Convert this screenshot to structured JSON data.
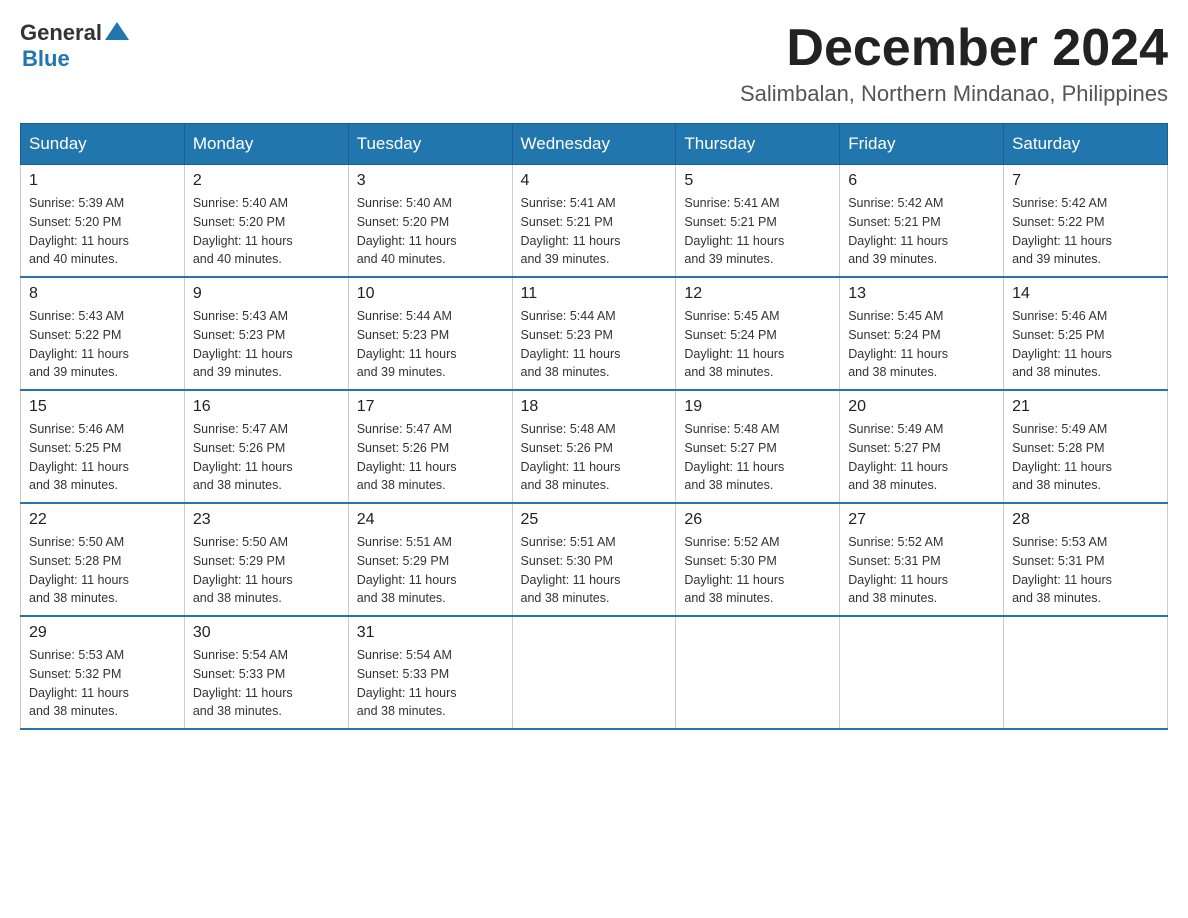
{
  "header": {
    "logo_general": "General",
    "logo_blue": "Blue",
    "month_title": "December 2024",
    "location": "Salimbalan, Northern Mindanao, Philippines"
  },
  "days_of_week": [
    "Sunday",
    "Monday",
    "Tuesday",
    "Wednesday",
    "Thursday",
    "Friday",
    "Saturday"
  ],
  "weeks": [
    [
      {
        "date": "1",
        "sunrise": "5:39 AM",
        "sunset": "5:20 PM",
        "daylight": "11 hours and 40 minutes."
      },
      {
        "date": "2",
        "sunrise": "5:40 AM",
        "sunset": "5:20 PM",
        "daylight": "11 hours and 40 minutes."
      },
      {
        "date": "3",
        "sunrise": "5:40 AM",
        "sunset": "5:20 PM",
        "daylight": "11 hours and 40 minutes."
      },
      {
        "date": "4",
        "sunrise": "5:41 AM",
        "sunset": "5:21 PM",
        "daylight": "11 hours and 39 minutes."
      },
      {
        "date": "5",
        "sunrise": "5:41 AM",
        "sunset": "5:21 PM",
        "daylight": "11 hours and 39 minutes."
      },
      {
        "date": "6",
        "sunrise": "5:42 AM",
        "sunset": "5:21 PM",
        "daylight": "11 hours and 39 minutes."
      },
      {
        "date": "7",
        "sunrise": "5:42 AM",
        "sunset": "5:22 PM",
        "daylight": "11 hours and 39 minutes."
      }
    ],
    [
      {
        "date": "8",
        "sunrise": "5:43 AM",
        "sunset": "5:22 PM",
        "daylight": "11 hours and 39 minutes."
      },
      {
        "date": "9",
        "sunrise": "5:43 AM",
        "sunset": "5:23 PM",
        "daylight": "11 hours and 39 minutes."
      },
      {
        "date": "10",
        "sunrise": "5:44 AM",
        "sunset": "5:23 PM",
        "daylight": "11 hours and 39 minutes."
      },
      {
        "date": "11",
        "sunrise": "5:44 AM",
        "sunset": "5:23 PM",
        "daylight": "11 hours and 38 minutes."
      },
      {
        "date": "12",
        "sunrise": "5:45 AM",
        "sunset": "5:24 PM",
        "daylight": "11 hours and 38 minutes."
      },
      {
        "date": "13",
        "sunrise": "5:45 AM",
        "sunset": "5:24 PM",
        "daylight": "11 hours and 38 minutes."
      },
      {
        "date": "14",
        "sunrise": "5:46 AM",
        "sunset": "5:25 PM",
        "daylight": "11 hours and 38 minutes."
      }
    ],
    [
      {
        "date": "15",
        "sunrise": "5:46 AM",
        "sunset": "5:25 PM",
        "daylight": "11 hours and 38 minutes."
      },
      {
        "date": "16",
        "sunrise": "5:47 AM",
        "sunset": "5:26 PM",
        "daylight": "11 hours and 38 minutes."
      },
      {
        "date": "17",
        "sunrise": "5:47 AM",
        "sunset": "5:26 PM",
        "daylight": "11 hours and 38 minutes."
      },
      {
        "date": "18",
        "sunrise": "5:48 AM",
        "sunset": "5:26 PM",
        "daylight": "11 hours and 38 minutes."
      },
      {
        "date": "19",
        "sunrise": "5:48 AM",
        "sunset": "5:27 PM",
        "daylight": "11 hours and 38 minutes."
      },
      {
        "date": "20",
        "sunrise": "5:49 AM",
        "sunset": "5:27 PM",
        "daylight": "11 hours and 38 minutes."
      },
      {
        "date": "21",
        "sunrise": "5:49 AM",
        "sunset": "5:28 PM",
        "daylight": "11 hours and 38 minutes."
      }
    ],
    [
      {
        "date": "22",
        "sunrise": "5:50 AM",
        "sunset": "5:28 PM",
        "daylight": "11 hours and 38 minutes."
      },
      {
        "date": "23",
        "sunrise": "5:50 AM",
        "sunset": "5:29 PM",
        "daylight": "11 hours and 38 minutes."
      },
      {
        "date": "24",
        "sunrise": "5:51 AM",
        "sunset": "5:29 PM",
        "daylight": "11 hours and 38 minutes."
      },
      {
        "date": "25",
        "sunrise": "5:51 AM",
        "sunset": "5:30 PM",
        "daylight": "11 hours and 38 minutes."
      },
      {
        "date": "26",
        "sunrise": "5:52 AM",
        "sunset": "5:30 PM",
        "daylight": "11 hours and 38 minutes."
      },
      {
        "date": "27",
        "sunrise": "5:52 AM",
        "sunset": "5:31 PM",
        "daylight": "11 hours and 38 minutes."
      },
      {
        "date": "28",
        "sunrise": "5:53 AM",
        "sunset": "5:31 PM",
        "daylight": "11 hours and 38 minutes."
      }
    ],
    [
      {
        "date": "29",
        "sunrise": "5:53 AM",
        "sunset": "5:32 PM",
        "daylight": "11 hours and 38 minutes."
      },
      {
        "date": "30",
        "sunrise": "5:54 AM",
        "sunset": "5:33 PM",
        "daylight": "11 hours and 38 minutes."
      },
      {
        "date": "31",
        "sunrise": "5:54 AM",
        "sunset": "5:33 PM",
        "daylight": "11 hours and 38 minutes."
      },
      null,
      null,
      null,
      null
    ]
  ],
  "labels": {
    "sunrise": "Sunrise:",
    "sunset": "Sunset:",
    "daylight": "Daylight:"
  }
}
